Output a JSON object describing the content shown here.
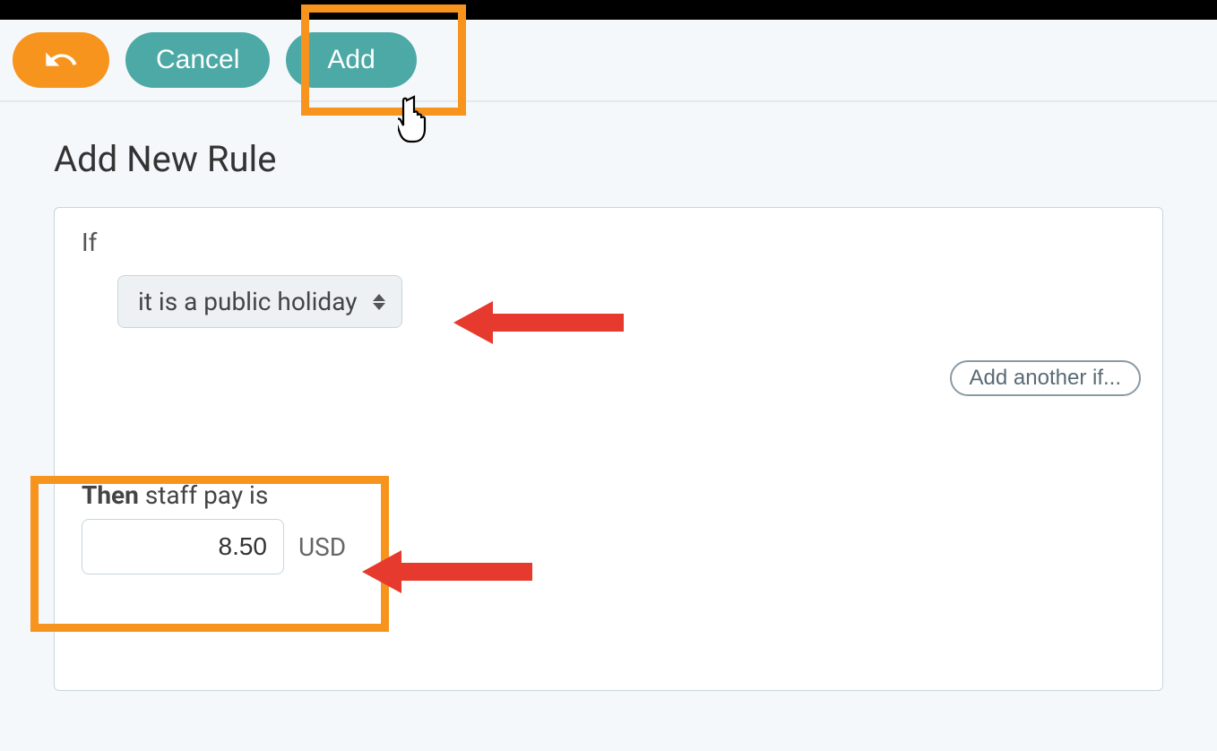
{
  "toolbar": {
    "cancel_label": "Cancel",
    "add_label": "Add"
  },
  "page": {
    "title": "Add New Rule"
  },
  "rule": {
    "if_label": "If",
    "condition_selected": "it is a public holiday",
    "add_another_if_label": "Add another if...",
    "then_label": "Then",
    "then_text": "staff pay is",
    "value": "8.50",
    "currency": "USD"
  },
  "annotations": {
    "highlight_color": "#f7941d",
    "arrow_color": "#e63a2e"
  }
}
